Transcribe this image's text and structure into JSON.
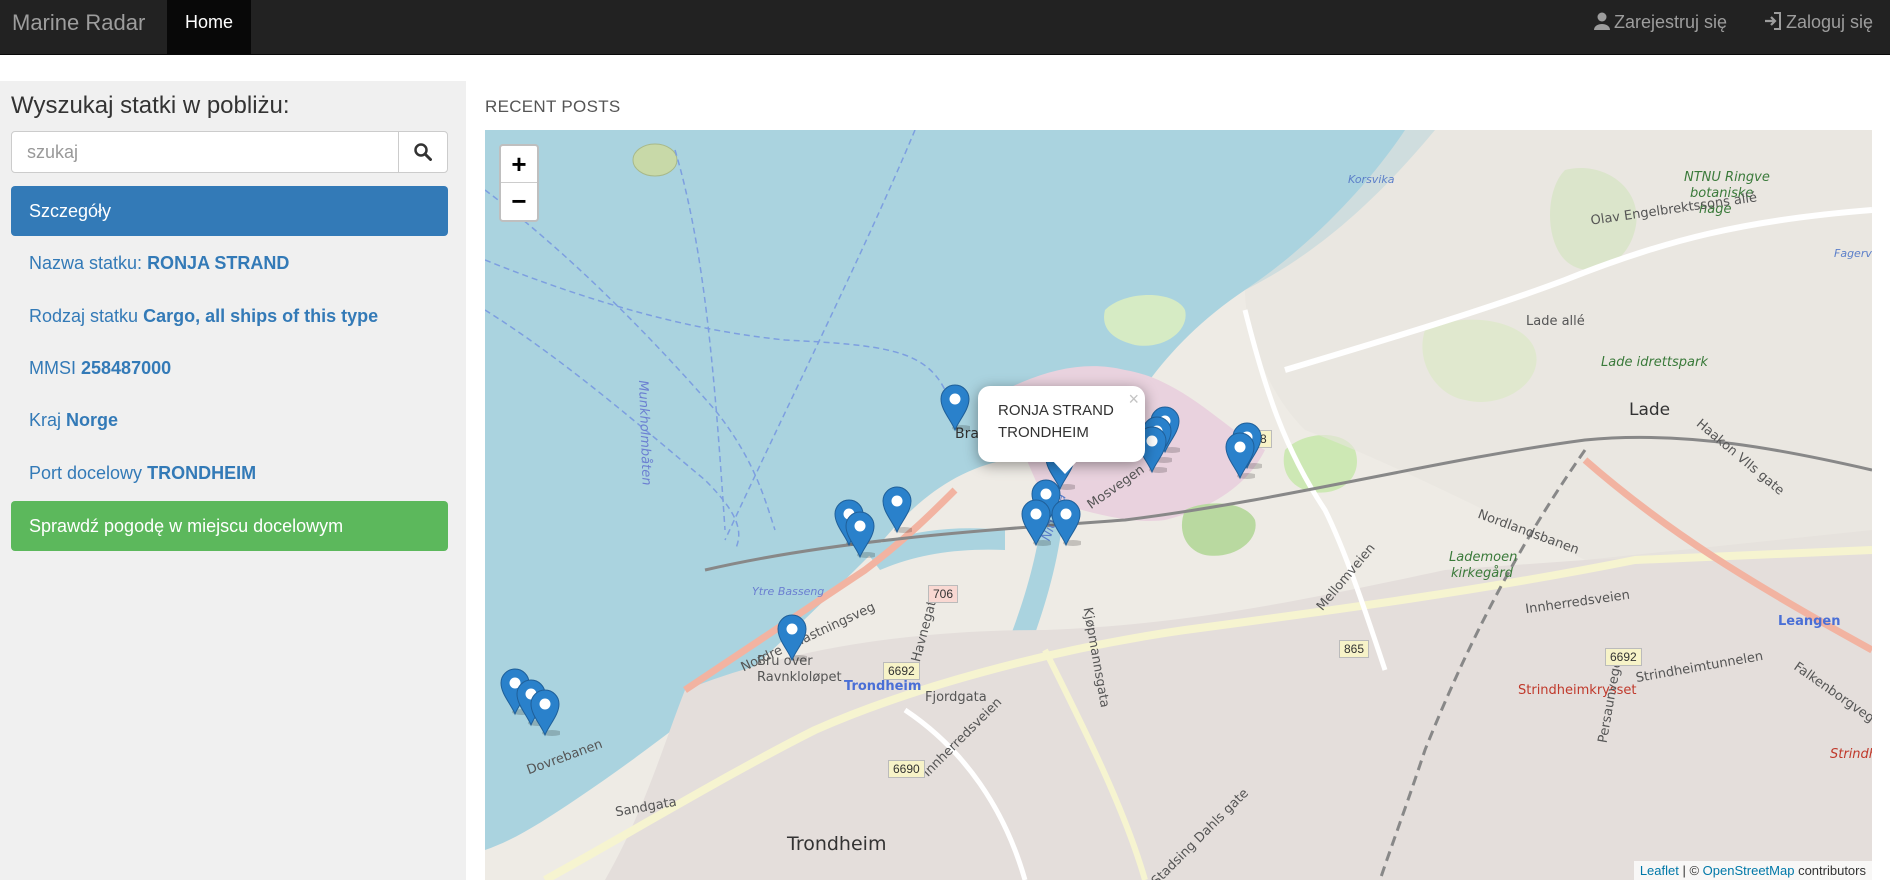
{
  "navbar": {
    "brand": "Marine Radar",
    "home": "Home",
    "register": "Zarejestruj się",
    "login": "Zaloguj się",
    "register_icon": "user-icon",
    "login_icon": "login-icon"
  },
  "sidebar": {
    "title": "Wyszukaj statki w pobliżu:",
    "search_placeholder": "szukaj",
    "search_icon": "search-icon",
    "details_header": "Szczegóły",
    "rows": [
      {
        "label": "Nazwa statku:",
        "value": "RONJA STRAND"
      },
      {
        "label": "Rodzaj statku",
        "value": "Cargo, all ships of this type"
      },
      {
        "label": "MMSI",
        "value": "258487000"
      },
      {
        "label": "Kraj",
        "value": "Norge"
      },
      {
        "label": "Port docelowy",
        "value": "TRONDHEIM"
      }
    ],
    "weather_button": "Sprawdź pogodę w miejscu docelowym"
  },
  "main": {
    "section_title": "RECENT POSTS",
    "zoom_in": "+",
    "zoom_out": "−",
    "popup": {
      "line1": "RONJA STRAND",
      "line2": "TRONDHEIM",
      "close": "×"
    },
    "attribution": {
      "leaflet": "Leaflet",
      "sep": " | © ",
      "osm": "OpenStreetMap",
      "suffix": " contributors"
    },
    "map_labels": {
      "brattora": "Brattøra",
      "trondheim_city": "Trondheim",
      "trondheim_station": "Trondheim",
      "lade": "Lade",
      "lade_alle": "Lade allé",
      "lade_idrettspark": "Lade idrettspark",
      "ntnu": "NTNU Ringve",
      "ntnu2": "botaniske",
      "ntnu3": "hage",
      "olav": "Olav Engelbrektssons allé",
      "munkholmbaten": "Munkholmbåten",
      "nordlandsbanen": "Nordlandsbanen",
      "lademoen": "Lademoen",
      "kirkegard": "kirkegård",
      "innherredsveien": "Innherredsveien",
      "strindheimtunnelen": "Strindheimtunnelen",
      "strindheimkrysset": "Strindheimkrysset",
      "leangen": "Leangen",
      "korsvika": "Korsvika",
      "fagervika": "Fagerv",
      "fjordgata": "Fjordgata",
      "sandgata": "Sandgata",
      "dovrebanen": "Dovrebanen",
      "nordre": "Nordre avlastningsveg",
      "bru_over": "Bru over",
      "ravnkloløpet": "Ravnkloløpet",
      "mellomveien": "Mellomveien",
      "persaunvegen": "Persaunvegen",
      "falkenborgvegen": "Falkenborgvegen",
      "strindheim": "Strindhe",
      "haakon": "Haakon VIIs gate",
      "stadsing": "Stadsing Dahls gate",
      "nidelva": "Nidelva",
      "kjopmannsgata": "Kjøpmannsgata",
      "innherredsveien2": "Innherredsveien",
      "mosvegen": "Mosvegen",
      "havnegata": "Havnegata",
      "yrre": "Ytre Basseng"
    },
    "road_badges": {
      "r706": "706",
      "r6668": "6668",
      "r6692a": "6692",
      "r6692b": "6692",
      "r865": "865",
      "r6690": "6690"
    },
    "marker_icon": "map-marker-icon"
  },
  "colors": {
    "navbar_bg": "#222222",
    "primary": "#337ab7",
    "success": "#5cb85c",
    "water": "#aad3df",
    "sidebar_bg": "#f0f0f0",
    "marker": "#2a81cb"
  }
}
